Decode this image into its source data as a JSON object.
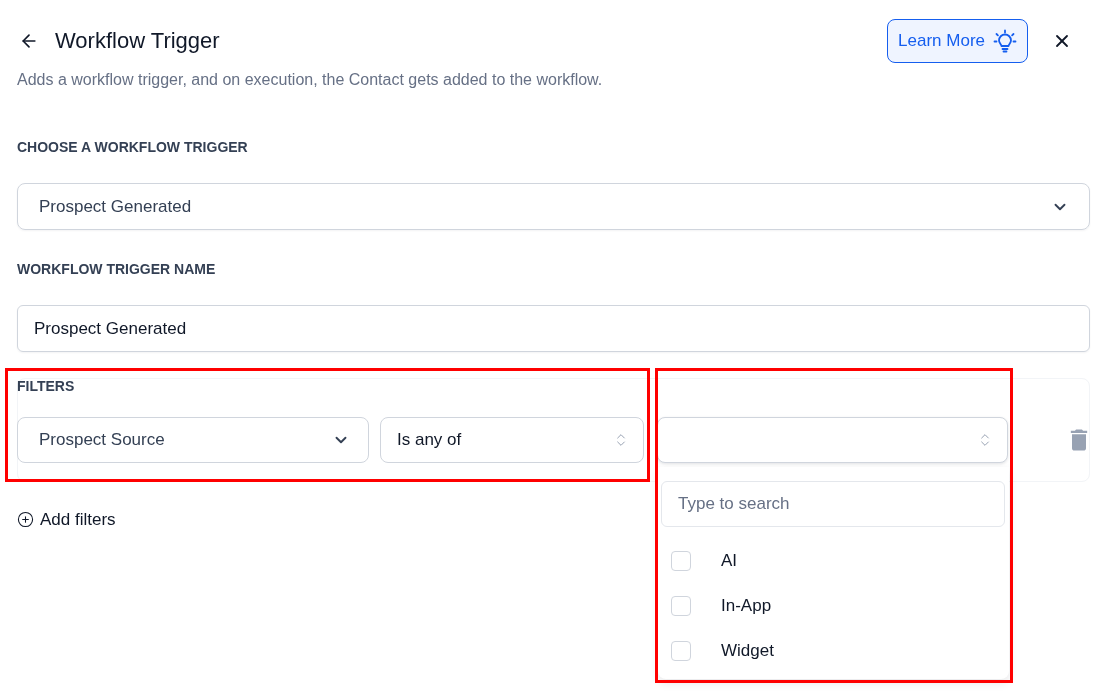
{
  "header": {
    "title": "Workflow Trigger",
    "learn_more": "Learn More",
    "subtitle": "Adds a workflow trigger, and on execution, the Contact gets added to the workflow."
  },
  "trigger": {
    "label": "CHOOSE A WORKFLOW TRIGGER",
    "value": "Prospect Generated"
  },
  "trigger_name": {
    "label": "WORKFLOW TRIGGER NAME",
    "value": "Prospect Generated"
  },
  "filters": {
    "label": "FILTERS",
    "highlighted": true,
    "rows": [
      {
        "field": "Prospect Source",
        "operator": "Is any of",
        "value_select": {
          "highlighted": true,
          "expanded": true,
          "search_placeholder": "Type to search",
          "options": [
            {
              "label": "AI",
              "checked": false
            },
            {
              "label": "In-App",
              "checked": false
            },
            {
              "label": "Widget",
              "checked": false
            }
          ]
        }
      }
    ]
  },
  "add_filters": "Add filters"
}
